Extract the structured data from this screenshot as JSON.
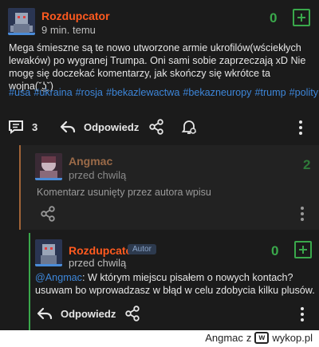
{
  "post": {
    "username": "Rozdupcator",
    "time": "9 min. temu",
    "score": "0",
    "text": "Mega śmieszne są te nowo utworzone armie ukrofilów(wściekłych lewaków) po wygranej Trumpa. Oni sami sobie zaprzeczają xD Nie mogę się doczekać komentarzy, jak skończy się wkrótce ta wojna(ˇ͜ʖˇ)",
    "tags": [
      "#usa",
      "#ukraina",
      "#rosja",
      "#bekazlewactwa",
      "#bekazneuropy",
      "#trump",
      "#polityka"
    ],
    "comment_count": "3",
    "reply_label": "Odpowiedz"
  },
  "comment1": {
    "username": "Angmac",
    "time": "przed chwilą",
    "score": "2",
    "text": "Komentarz usunięty przez autora wpisu"
  },
  "comment2": {
    "username": "Rozdupcator",
    "badge": "Autor",
    "time": "przed chwilą",
    "score": "0",
    "mention": "@Angmac",
    "text": ": W którym miejscu pisałem o nowych kontach? usuwam bo wprowadzasz w błąd w celu zdobycia kilku plusów.",
    "reply_label": "Odpowiedz"
  },
  "footer": {
    "author": "Angmac",
    "z": "z",
    "site": "wykop.pl"
  },
  "colors": {
    "accent_orange": "#ff5a1f",
    "accent_green": "#3aa84b",
    "link_blue": "#3d86d9"
  }
}
